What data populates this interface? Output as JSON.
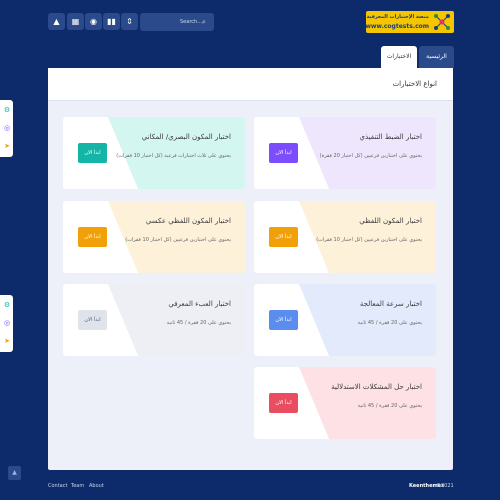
{
  "topbar": {
    "icons": [
      "image-icon",
      "grid-icon",
      "bug-icon",
      "bar-chart-icon",
      "expand-icon"
    ],
    "search_placeholder": "Search...",
    "logo_line1": "منصة الإختبارات المعرفية",
    "logo_line2": "www.cogtests.com"
  },
  "tabs": {
    "active": "الاختبارات",
    "home": "الرئيسية"
  },
  "main": {
    "title": "انواع الاختبارات"
  },
  "cards": [
    {
      "title": "اختبار الضبط التنفيذي",
      "desc": "يحتوي على اختبارين فرعيين (كل اختبار 20 فقرة)",
      "button": "ابدأ الان",
      "accent": "#7c4dff",
      "band": "#ede6fd"
    },
    {
      "title": "اختبار المكون البصري/ المكاني",
      "desc": "يحتوي على ثلاث اختبارات فرعية (كل اختبار 10 فقرات)",
      "button": "ابدأ الان",
      "accent": "#12b5a6",
      "band": "#d3f6f1"
    },
    {
      "title": "اختبار المكون اللفظي",
      "desc": "يحتوي على اختبارين فرعيين (كل اختبار 10 فقرات)",
      "button": "ابدأ الان",
      "accent": "#f2a007",
      "band": "#fdf1d9"
    },
    {
      "title": "اختبار المكون اللفظي عكسي",
      "desc": "يحتوي على اختبارين فرعيين (كل اختبار 10 فقرات)",
      "button": "ابدأ الان",
      "accent": "#f2a007",
      "band": "#fdf1d9"
    },
    {
      "title": "اختبار سرعة المعالجة",
      "desc": "يحتوي على 20 فقرة / 45 ثانية",
      "button": "ابدأ الان",
      "accent": "#5b8def",
      "band": "#e2eafc"
    },
    {
      "title": "اختبار العبء المعرفي",
      "desc": "يحتوي على 20 فقرة / 45 ثانية",
      "button": "ابدأ الان",
      "accent": "#dfe3ec",
      "band": "#edeff5"
    },
    {
      "title": "اختبار حل المشكلات الاستدلالية",
      "desc": "يحتوي على 20 فقرة / 45 ثانية",
      "button": "ابدأ الان",
      "accent": "#ea4d5f",
      "band": "#fde1e4"
    }
  ],
  "footer": {
    "links": [
      "Contact",
      "Team",
      "About"
    ],
    "brand": "Keenthemes",
    "year": "©2021"
  }
}
